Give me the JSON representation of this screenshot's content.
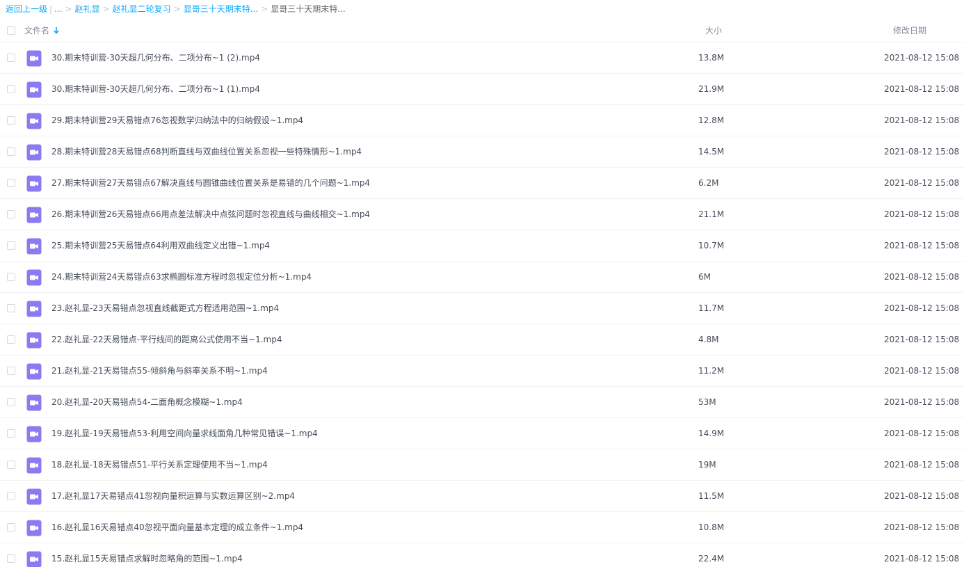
{
  "breadcrumb": {
    "back": "返回上一级",
    "pipe": "|",
    "ellipsis": "...",
    "items": [
      "赵礼显",
      "赵礼显二轮复习",
      "显哥三十天期末特..."
    ],
    "current": "显哥三十天期末特...",
    "separator": ">"
  },
  "header": {
    "name": "文件名",
    "size": "大小",
    "date": "修改日期"
  },
  "colors": {
    "link": "#09aaff",
    "video_icon": "#8b7bf0"
  },
  "files": [
    {
      "name": "30.期末特训营-30天超几何分布、二项分布~1 (2).mp4",
      "size": "13.8M",
      "date": "2021-08-12 15:08",
      "icon": "video-file-icon"
    },
    {
      "name": "30.期末特训营-30天超几何分布、二项分布~1 (1).mp4",
      "size": "21.9M",
      "date": "2021-08-12 15:08",
      "icon": "video-file-icon"
    },
    {
      "name": "29.期末特训营29天易错点76忽视数学归纳法中的归纳假设~1.mp4",
      "size": "12.8M",
      "date": "2021-08-12 15:08",
      "icon": "video-file-icon"
    },
    {
      "name": "28.期末特训营28天易错点68判断直线与双曲线位置关系忽视一些特殊情形~1.mp4",
      "size": "14.5M",
      "date": "2021-08-12 15:08",
      "icon": "video-file-icon"
    },
    {
      "name": "27.期末特训营27天易错点67解决直线与圆锥曲线位置关系是易错的几个问题~1.mp4",
      "size": "6.2M",
      "date": "2021-08-12 15:08",
      "icon": "video-file-icon"
    },
    {
      "name": "26.期末特训营26天易错点66用点差法解决中点弦问题时忽视直线与曲线相交~1.mp4",
      "size": "21.1M",
      "date": "2021-08-12 15:08",
      "icon": "video-file-icon"
    },
    {
      "name": "25.期末特训营25天易错点64利用双曲线定义出错~1.mp4",
      "size": "10.7M",
      "date": "2021-08-12 15:08",
      "icon": "video-file-icon"
    },
    {
      "name": "24.期末特训营24天易错点63求椭圆标准方程时忽视定位分析~1.mp4",
      "size": "6M",
      "date": "2021-08-12 15:08",
      "icon": "video-file-icon"
    },
    {
      "name": "23.赵礼显-23天易错点忽视直线截距式方程适用范围~1.mp4",
      "size": "11.7M",
      "date": "2021-08-12 15:08",
      "icon": "video-file-icon"
    },
    {
      "name": "22.赵礼显-22天易错点-平行线间的距离公式使用不当~1.mp4",
      "size": "4.8M",
      "date": "2021-08-12 15:08",
      "icon": "video-file-icon"
    },
    {
      "name": "21.赵礼显-21天易错点55-倾斜角与斜率关系不明~1.mp4",
      "size": "11.2M",
      "date": "2021-08-12 15:08",
      "icon": "video-file-icon"
    },
    {
      "name": "20.赵礼显-20天易错点54-二面角概念模糊~1.mp4",
      "size": "53M",
      "date": "2021-08-12 15:08",
      "icon": "video-file-icon"
    },
    {
      "name": "19.赵礼显-19天易错点53-利用空间向量求线面角几种常见错误~1.mp4",
      "size": "14.9M",
      "date": "2021-08-12 15:08",
      "icon": "video-file-icon"
    },
    {
      "name": "18.赵礼显-18天易错点51-平行关系定理使用不当~1.mp4",
      "size": "19M",
      "date": "2021-08-12 15:08",
      "icon": "video-file-icon"
    },
    {
      "name": "17.赵礼显17天易错点41忽视向量积运算与实数运算区别~2.mp4",
      "size": "11.5M",
      "date": "2021-08-12 15:08",
      "icon": "video-file-icon"
    },
    {
      "name": "16.赵礼显16天易错点40忽视平面向量基本定理的成立条件~1.mp4",
      "size": "10.8M",
      "date": "2021-08-12 15:08",
      "icon": "video-file-icon"
    },
    {
      "name": "15.赵礼显15天易错点求解时忽略角的范围~1.mp4",
      "size": "22.4M",
      "date": "2021-08-12 15:08",
      "icon": "video-file-icon"
    }
  ]
}
